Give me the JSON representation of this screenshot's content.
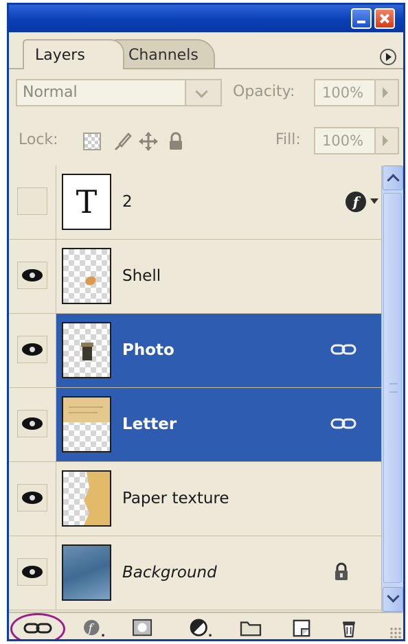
{
  "panel": {
    "tabs": [
      {
        "label": "Layers",
        "active": true
      },
      {
        "label": "Channels",
        "active": false
      }
    ]
  },
  "options": {
    "blend_mode": "Normal",
    "opacity_label": "Opacity:",
    "opacity_value": "100%",
    "lock_label": "Lock:",
    "fill_label": "Fill:",
    "fill_value": "100%"
  },
  "layers": [
    {
      "name": "2",
      "thumbnail": "T",
      "visible": false,
      "selected": false,
      "badge": "fx-icon"
    },
    {
      "name": "Shell",
      "visible": true,
      "selected": false
    },
    {
      "name": "Photo",
      "visible": true,
      "selected": true,
      "badge": "link-icon"
    },
    {
      "name": "Letter",
      "visible": true,
      "selected": true,
      "badge": "link-icon"
    },
    {
      "name": "Paper texture",
      "visible": true,
      "selected": false
    },
    {
      "name": "Background",
      "visible": true,
      "selected": false,
      "badge": "lock-icon"
    }
  ],
  "bottom_icons": [
    "link-layers-icon",
    "layer-style-icon",
    "layer-mask-icon",
    "adjustment-layer-icon",
    "new-group-icon",
    "new-layer-icon",
    "delete-layer-icon"
  ],
  "colors": {
    "selected_row": "#2e5cb0",
    "title_bar": "#0a3fb5",
    "highlight_circle": "#9b1d8c"
  }
}
